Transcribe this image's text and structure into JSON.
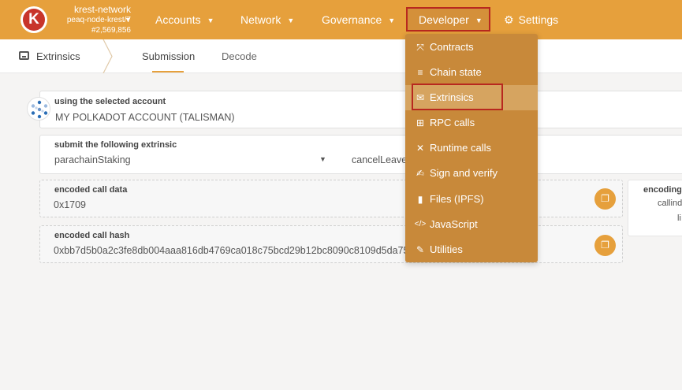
{
  "chain": {
    "name": "krest-network",
    "node": "peaq-node-krest/7",
    "block": "#2,569,856",
    "logo_letter": "K"
  },
  "nav": {
    "accounts": "Accounts",
    "network": "Network",
    "governance": "Governance",
    "developer": "Developer",
    "settings": "Settings"
  },
  "subheader": {
    "title": "Extrinsics",
    "tabs": [
      "Submission",
      "Decode"
    ]
  },
  "account": {
    "label": "using the selected account",
    "value": "MY POLKADOT ACCOUNT (TALISMAN)"
  },
  "extrinsic": {
    "label": "submit the following extrinsic",
    "module": "parachainStaking",
    "method": "cancelLeaveC"
  },
  "call_data": {
    "label": "encoded call data",
    "value": "0x1709"
  },
  "call_hash": {
    "label": "encoded call hash",
    "value": "0xbb7d5b0a2c3fe8db004aaa816db4769ca018c75bcd29b12bc8090c8109d5da75"
  },
  "encoding_panel": {
    "line1": "encoding",
    "line2": "callind",
    "line3": "li"
  },
  "developer_menu": [
    {
      "label": "Contracts",
      "icon": "contracts-icon",
      "glyph": "⤧"
    },
    {
      "label": "Chain state",
      "icon": "database-icon",
      "glyph": "≡"
    },
    {
      "label": "Extrinsics",
      "icon": "envelope-icon",
      "glyph": "✉"
    },
    {
      "label": "RPC calls",
      "icon": "network-icon",
      "glyph": "⊞"
    },
    {
      "label": "Runtime calls",
      "icon": "runtime-icon",
      "glyph": "✕"
    },
    {
      "label": "Sign and verify",
      "icon": "signature-icon",
      "glyph": "✍"
    },
    {
      "label": "Files (IPFS)",
      "icon": "file-icon",
      "glyph": "▮"
    },
    {
      "label": "JavaScript",
      "icon": "code-icon",
      "glyph": "</>"
    },
    {
      "label": "Utilities",
      "icon": "wrench-icon",
      "glyph": "✎"
    }
  ],
  "colors": {
    "topbar": "#e6a03c",
    "dropdown": "#c8893a",
    "highlight_border": "#b8281f"
  }
}
